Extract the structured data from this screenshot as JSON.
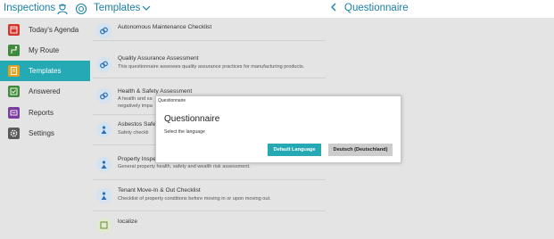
{
  "header": {
    "app_title": "Inspections",
    "dropdown_label": "Templates",
    "page_title": "Questionnaire"
  },
  "sidebar": {
    "items": [
      {
        "label": "Today's Agenda",
        "icon": "calendar-icon",
        "color": "#d6342d"
      },
      {
        "label": "My Route",
        "icon": "route-icon",
        "color": "#3f8a3c"
      },
      {
        "label": "Templates",
        "icon": "template-icon",
        "color": "#e6a21c",
        "active": true
      },
      {
        "label": "Answered",
        "icon": "answered-icon",
        "color": "#3f8a3c"
      },
      {
        "label": "Reports",
        "icon": "reports-icon",
        "color": "#7a3c9e"
      },
      {
        "label": "Settings",
        "icon": "gear-icon",
        "color": "#5a5a5a"
      }
    ]
  },
  "templates": [
    {
      "title": "Autonomous Maintenance Checklist",
      "subtitle": ""
    },
    {
      "title": "Quality Assurance Assessment",
      "subtitle": "This questionnaire assesses quality assurance practices for manufacturing products."
    },
    {
      "title": "Health & Safety Assessment",
      "subtitle": "A health and sa",
      "subtitle2": "negatively impa"
    },
    {
      "title": "Asbestos Safe",
      "subtitle": "Safety checkli"
    },
    {
      "title": "Property Inspe",
      "subtitle": "General property health, safety and wealth risk assessment."
    },
    {
      "title": "Tenant Move-In & Out Checklist",
      "subtitle": "Checklist of property conditions before moving in or upon moving out."
    },
    {
      "title": "localize",
      "subtitle": ""
    }
  ],
  "dialog": {
    "caption": "Questionnaire",
    "title": "Questionnaire",
    "message": "Select the language",
    "primary_button": "Default Language",
    "secondary_button": "Deutsch (Deutschland)"
  },
  "colors": {
    "accent": "#25a9b4",
    "link": "#1a7fa6",
    "overlay": "#e4e4e4"
  }
}
